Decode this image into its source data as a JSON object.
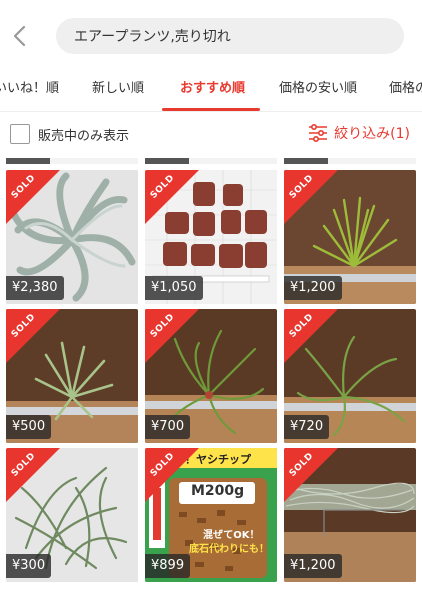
{
  "search": {
    "query": "エアープランツ,売り切れ"
  },
  "tabs": [
    {
      "label": "いいね！順",
      "active": false
    },
    {
      "label": "新しい順",
      "active": false
    },
    {
      "label": "おすすめ順",
      "active": true
    },
    {
      "label": "価格の安い順",
      "active": false
    },
    {
      "label": "価格の高い順",
      "active": false
    }
  ],
  "filter": {
    "on_sale_only_label": "販売中のみ表示",
    "narrow_label": "絞り込み(1)"
  },
  "colors": {
    "accent": "#e83a2f",
    "sold_badge": "#e8362f"
  },
  "products": [
    {
      "price": "¥2,380",
      "badge": "SOLD",
      "image": "xerographica"
    },
    {
      "price": "¥1,050",
      "badge": "SOLD",
      "image": "lava-stones"
    },
    {
      "price": "¥1,200",
      "badge": "SOLD",
      "image": "airplant-wood"
    },
    {
      "price": "¥500",
      "badge": "SOLD",
      "image": "airplant-small"
    },
    {
      "price": "¥700",
      "badge": "SOLD",
      "image": "airplant-curly"
    },
    {
      "price": "¥720",
      "badge": "SOLD",
      "image": "airplant-curly-2"
    },
    {
      "price": "¥300",
      "badge": "SOLD",
      "image": "airplant-bunch"
    },
    {
      "price": "¥899",
      "badge": "SOLD",
      "image": "palm-chip-bag",
      "bag_banner": "グン！ヤシチップ",
      "bag_size": "M200g",
      "bag_note_1": "混ぜてOK！",
      "bag_note_2": "底石代わりにも！"
    },
    {
      "price": "¥1,200",
      "badge": "SOLD",
      "image": "tillandsia-usneoides"
    }
  ]
}
